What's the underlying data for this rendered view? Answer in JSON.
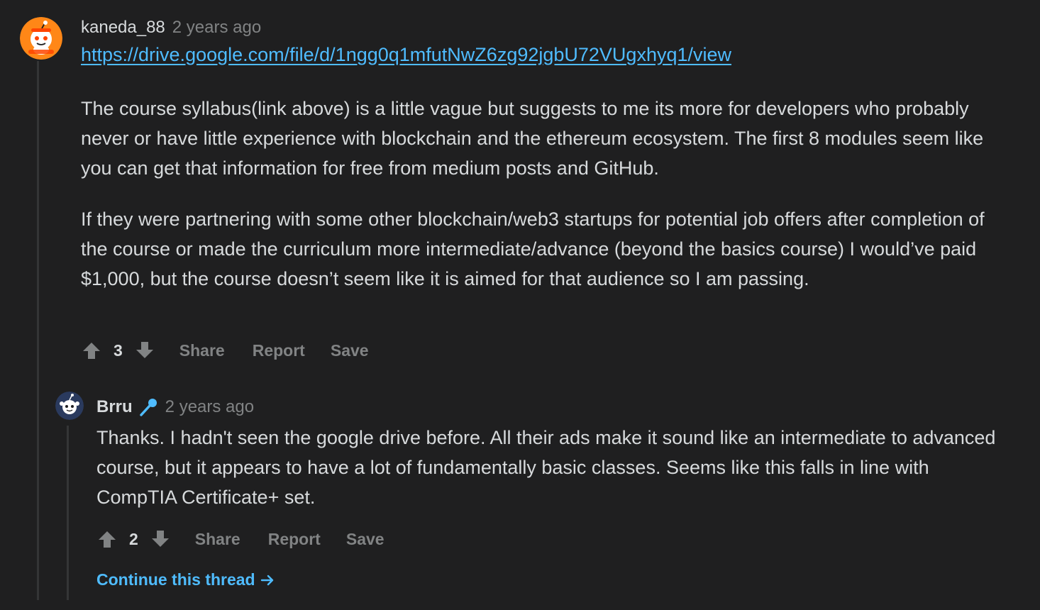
{
  "comment1": {
    "username": "kaneda_88",
    "timestamp": "2 years ago",
    "link": "https://drive.google.com/file/d/1ngg0q1mfutNwZ6zg92jgbU72VUgxhyq1/view",
    "paragraph1": "The course syllabus(link above) is a little vague but suggests to me its more for developers who probably never or have little experience with blockchain and the ethereum ecosystem. The first 8 modules seem like you can get that information for free from medium posts and GitHub.",
    "paragraph2": "If they were partnering with some other blockchain/web3 startups for potential job offers after completion of the course or made the curriculum more intermediate/advance (beyond the basics course) I would’ve paid $1,000, but the course doesn’t seem like it is aimed for that audience so I am passing.",
    "score": "3",
    "share_label": "Share",
    "report_label": "Report",
    "save_label": "Save"
  },
  "comment2": {
    "username": "Brru",
    "timestamp": "2 years ago",
    "text": "Thanks. I hadn't seen the google drive before. All their ads make it sound like an intermediate to advanced course, but it appears to have a lot of fundamentally basic classes. Seems like this falls in line with CompTIA Certificate+ set.",
    "score": "2",
    "share_label": "Share",
    "report_label": "Report",
    "save_label": "Save",
    "flair_icon": "microphone-icon"
  },
  "continue_thread_label": "Continue this thread",
  "colors": {
    "background": "#1f1f20",
    "text": "#d7dadc",
    "muted": "#818384",
    "link": "#4fbcff",
    "thread_line": "#343536",
    "avatar_orange": "#ff8717"
  }
}
